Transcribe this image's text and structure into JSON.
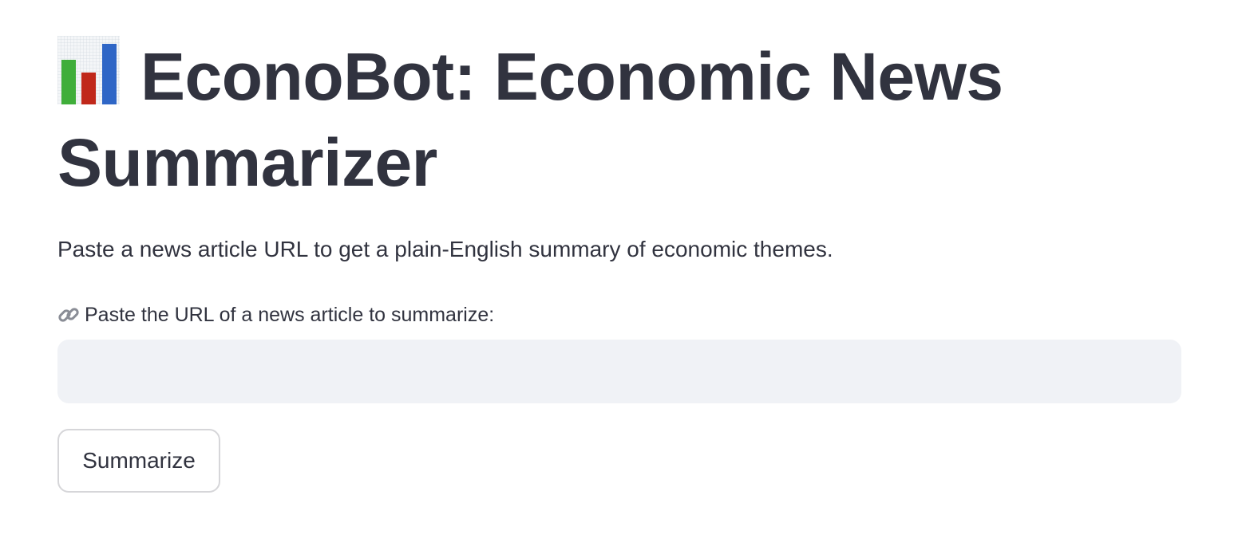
{
  "header": {
    "title": "EconoBot: Economic News Summarizer",
    "title_icon": "bar-chart-icon"
  },
  "intro": {
    "text": "Paste a news article URL to get a plain-English summary of economic themes."
  },
  "url_field": {
    "icon": "link-icon",
    "label": "Paste the URL of a news article to summarize:",
    "value": "",
    "placeholder": ""
  },
  "actions": {
    "summarize_label": "Summarize"
  },
  "colors": {
    "text": "#31333f",
    "input_background": "#f0f2f6",
    "button_border": "#d6d6d9",
    "chart_green": "#3fae3a",
    "chart_red": "#c0281b",
    "chart_blue": "#2f66c6"
  }
}
